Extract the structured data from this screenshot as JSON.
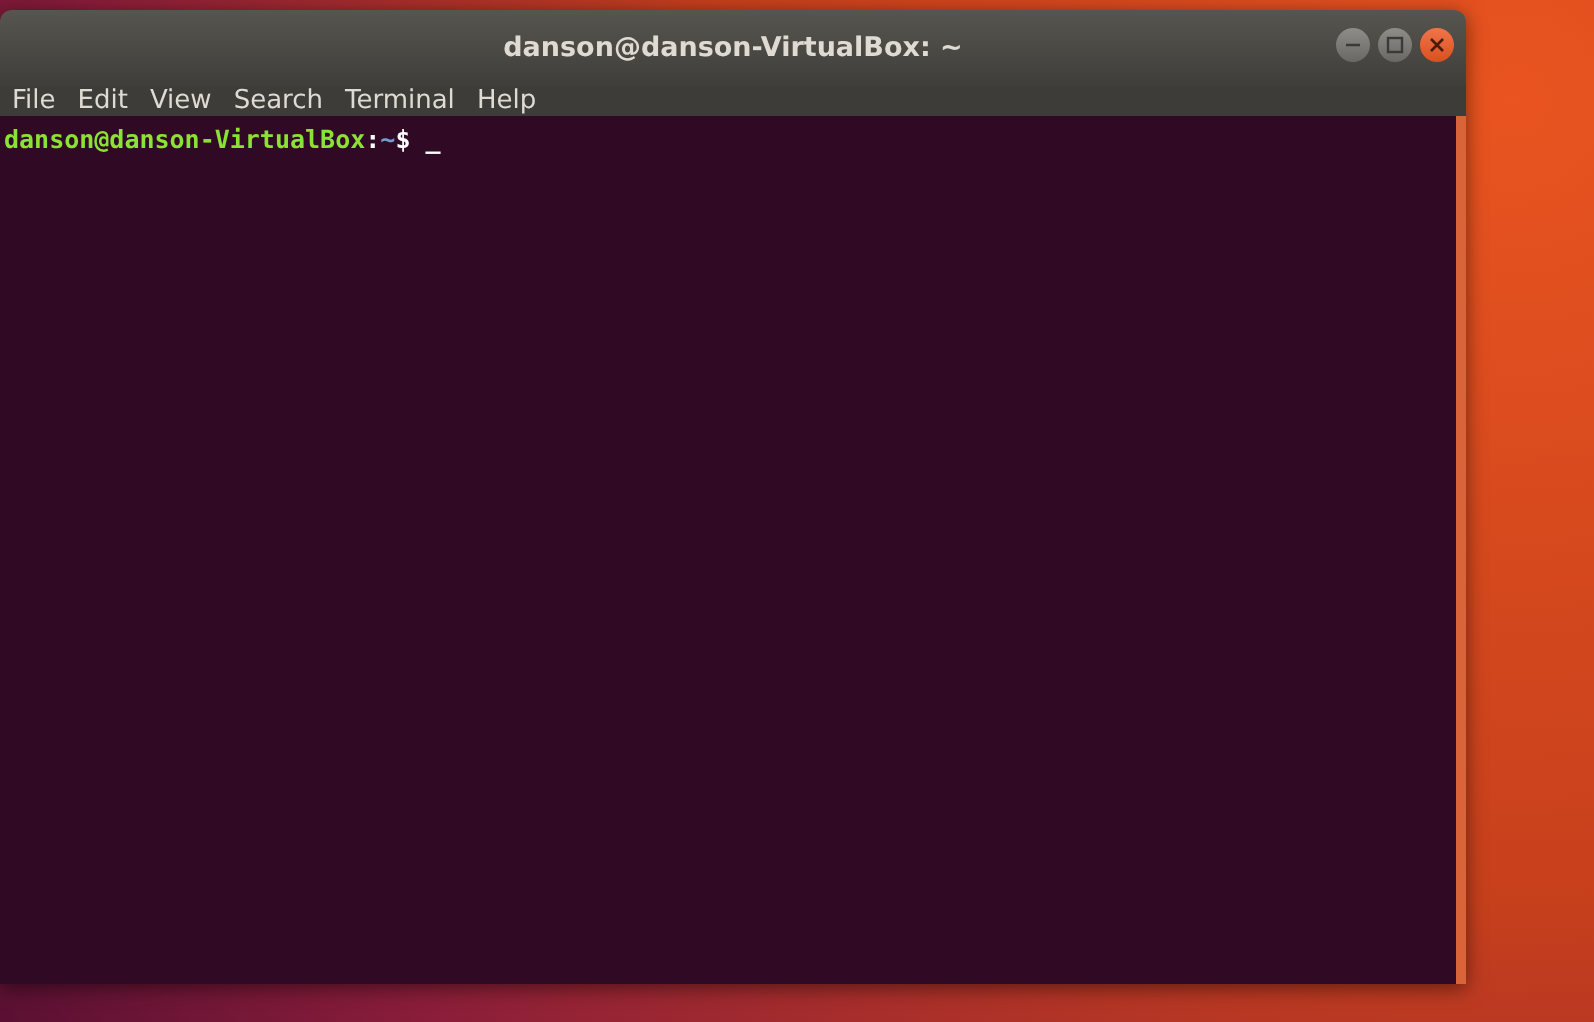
{
  "window": {
    "title": "danson@danson-VirtualBox: ~"
  },
  "menu": [
    "File",
    "Edit",
    "View",
    "Search",
    "Terminal",
    "Help"
  ],
  "prompt": {
    "user_host": "danson@danson-VirtualBox",
    "separator": ":",
    "path": "~",
    "symbol": "$",
    "cursor": "_"
  }
}
